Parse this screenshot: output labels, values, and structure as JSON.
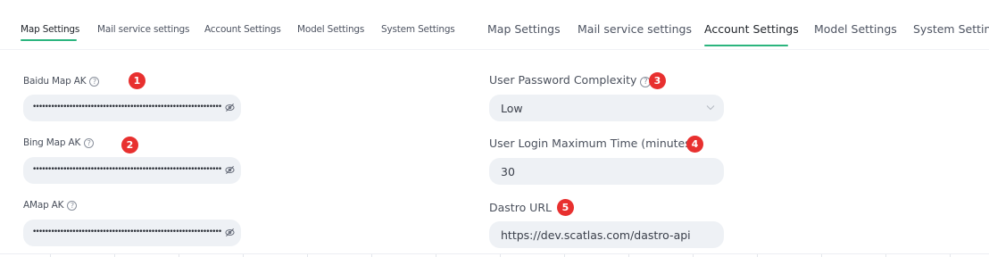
{
  "left_panel": {
    "tabs": [
      {
        "label": "Map Settings",
        "active": true
      },
      {
        "label": "Mail service settings",
        "active": false
      },
      {
        "label": "Account Settings",
        "active": false
      },
      {
        "label": "Model Settings",
        "active": false
      },
      {
        "label": "System Settings",
        "active": false
      }
    ],
    "fields": [
      {
        "label": "Baidu Map AK",
        "badge": "1",
        "value": "••••••••••••••••••••••••••••••••••••••••••••••••••••••••••••••••••••••••••",
        "type": "password"
      },
      {
        "label": "Bing Map AK",
        "badge": "2",
        "value": "••••••••••••••••••••••••••••••••••••••••••••••••••••••••••••••••••••••••••",
        "type": "password"
      },
      {
        "label": "AMap AK",
        "badge": "",
        "value": "••••••••••••••••••••••••••••••••••••••••••••••••••••••••••••••••••••••••••",
        "type": "password"
      }
    ]
  },
  "right_panel": {
    "tabs": [
      {
        "label": "Map Settings",
        "active": false
      },
      {
        "label": "Mail service settings",
        "active": false
      },
      {
        "label": "Account Settings",
        "active": true
      },
      {
        "label": "Model Settings",
        "active": false
      },
      {
        "label": "System Setting",
        "active": false
      }
    ],
    "fields": [
      {
        "label": "User Password Complexity",
        "badge": "3",
        "value": "Low",
        "type": "select"
      },
      {
        "label": "User Login Maximum Time (minutes)",
        "badge": "4",
        "value": "30",
        "type": "text"
      },
      {
        "label": "Dastro URL",
        "badge": "5",
        "value": "https://dev.scatlas.com/dastro-api",
        "type": "text"
      }
    ]
  },
  "colors": {
    "accent": "#2bb57e",
    "badge": "#e8302f",
    "input_bg": "#eef1f5"
  },
  "icons": {
    "help": "question-circle-icon",
    "eye": "eye-off-icon",
    "select": "chevron-down-icon"
  }
}
